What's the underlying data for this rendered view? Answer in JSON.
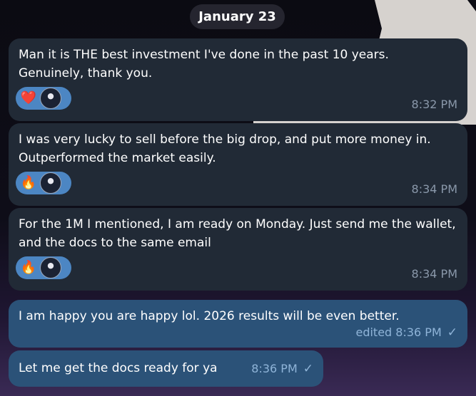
{
  "date_separator": "January 23",
  "messages": [
    {
      "direction": "incoming",
      "text": "Man it is THE best investment I've done in the past 10 years. Genuinely, thank you.",
      "reaction": "❤️",
      "time": "8:32 PM"
    },
    {
      "direction": "incoming",
      "text": "I was very lucky to sell before the big drop, and put more money in. Outperformed the market easily.",
      "reaction": "🔥",
      "time": "8:34 PM"
    },
    {
      "direction": "incoming",
      "text": "For the 1M I mentioned, I am ready on Monday. Just send me the wallet, and the docs to the same email",
      "reaction": "🔥",
      "time": "8:34 PM"
    },
    {
      "direction": "outgoing",
      "text": "I am happy you are happy lol. 2026 results will be even better.",
      "meta": "edited 8:36 PM",
      "status": "✓"
    },
    {
      "direction": "outgoing",
      "text": "Let me get the docs ready for ya",
      "meta": "8:36 PM",
      "status": "✓"
    }
  ],
  "colors": {
    "incoming_bubble": "#212a36",
    "outgoing_bubble": "#2b5278",
    "reaction_pill": "#4c86c3"
  }
}
